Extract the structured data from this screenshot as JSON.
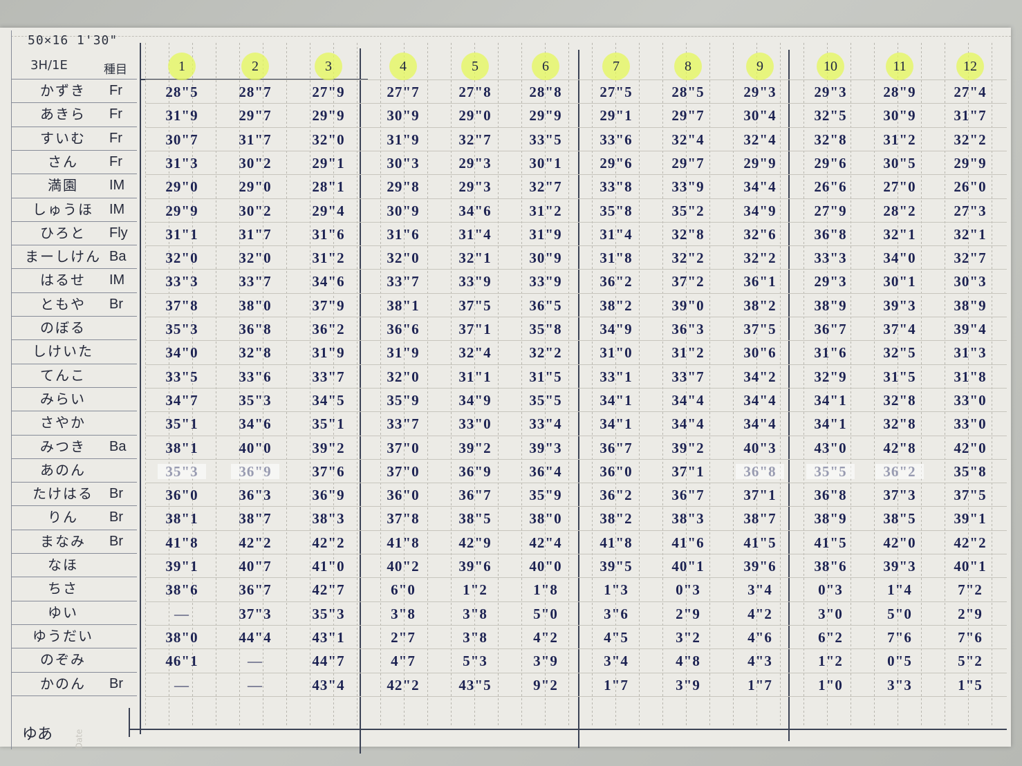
{
  "sheet": {
    "set_label": "50×16 1'30\"",
    "rule_label": "3H/1E",
    "kind_header": "種目",
    "last_name": "ゆあ",
    "date_label": "Date"
  },
  "columns": [
    "1",
    "2",
    "3",
    "4",
    "5",
    "6",
    "7",
    "8",
    "9",
    "10",
    "11",
    "12"
  ],
  "rows": [
    {
      "name": "かずき",
      "kind": "Fr",
      "times": [
        "28\"5",
        "28\"7",
        "27\"9",
        "27\"7",
        "27\"8",
        "28\"8",
        "27\"5",
        "28\"5",
        "29\"3",
        "29\"3",
        "28\"9",
        "27\"4"
      ]
    },
    {
      "name": "あきら",
      "kind": "Fr",
      "times": [
        "31\"9",
        "29\"7",
        "29\"9",
        "30\"9",
        "29\"0",
        "29\"9",
        "29\"1",
        "29\"7",
        "30\"4",
        "32\"5",
        "30\"9",
        "31\"7"
      ]
    },
    {
      "name": "すいむ",
      "kind": "Fr",
      "times": [
        "30\"7",
        "31\"7",
        "32\"0",
        "31\"9",
        "32\"7",
        "33\"5",
        "33\"6",
        "32\"4",
        "32\"4",
        "32\"8",
        "31\"2",
        "32\"2"
      ]
    },
    {
      "name": "さん",
      "kind": "Fr",
      "times": [
        "31\"3",
        "30\"2",
        "29\"1",
        "30\"3",
        "29\"3",
        "30\"1",
        "29\"6",
        "29\"7",
        "29\"9",
        "29\"6",
        "30\"5",
        "29\"9"
      ]
    },
    {
      "name": "満園",
      "kind": "IM",
      "times": [
        "29\"0",
        "29\"0",
        "28\"1",
        "29\"8",
        "29\"3",
        "32\"7",
        "33\"8",
        "33\"9",
        "34\"4",
        "26\"6",
        "27\"0",
        "26\"0"
      ]
    },
    {
      "name": "しゅうほ",
      "kind": "IM",
      "times": [
        "29\"9",
        "30\"2",
        "29\"4",
        "30\"9",
        "34\"6",
        "31\"2",
        "35\"8",
        "35\"2",
        "34\"9",
        "27\"9",
        "28\"2",
        "27\"3"
      ]
    },
    {
      "name": "ひろと",
      "kind": "Fly",
      "times": [
        "31\"1",
        "31\"7",
        "31\"6",
        "31\"6",
        "31\"4",
        "31\"9",
        "31\"4",
        "32\"8",
        "32\"6",
        "36\"8",
        "32\"1",
        "32\"1"
      ]
    },
    {
      "name": "まーしけん",
      "kind": "Ba",
      "times": [
        "32\"0",
        "32\"0",
        "31\"2",
        "32\"0",
        "32\"1",
        "30\"9",
        "31\"8",
        "32\"2",
        "32\"2",
        "33\"3",
        "34\"0",
        "32\"7"
      ]
    },
    {
      "name": "はるせ",
      "kind": "IM",
      "times": [
        "33\"3",
        "33\"7",
        "34\"6",
        "33\"7",
        "33\"9",
        "33\"9",
        "36\"2",
        "37\"2",
        "36\"1",
        "29\"3",
        "30\"1",
        "30\"3"
      ]
    },
    {
      "name": "ともや",
      "kind": "Br",
      "times": [
        "37\"8",
        "38\"0",
        "37\"9",
        "38\"1",
        "37\"5",
        "36\"5",
        "38\"2",
        "39\"0",
        "38\"2",
        "38\"9",
        "39\"3",
        "38\"9"
      ]
    },
    {
      "name": "のぼる",
      "kind": "",
      "times": [
        "35\"3",
        "36\"8",
        "36\"2",
        "36\"6",
        "37\"1",
        "35\"8",
        "34\"9",
        "36\"3",
        "37\"5",
        "36\"7",
        "37\"4",
        "39\"4"
      ]
    },
    {
      "name": "しけいた",
      "kind": "",
      "times": [
        "34\"0",
        "32\"8",
        "31\"9",
        "31\"9",
        "32\"4",
        "32\"2",
        "31\"0",
        "31\"2",
        "30\"6",
        "31\"6",
        "32\"5",
        "31\"3"
      ]
    },
    {
      "name": "てんこ",
      "kind": "",
      "times": [
        "33\"5",
        "33\"6",
        "33\"7",
        "32\"0",
        "31\"1",
        "31\"5",
        "33\"1",
        "33\"7",
        "34\"2",
        "32\"9",
        "31\"5",
        "31\"8"
      ]
    },
    {
      "name": "みらい",
      "kind": "",
      "times": [
        "34\"7",
        "35\"3",
        "34\"5",
        "35\"9",
        "34\"9",
        "35\"5",
        "34\"1",
        "34\"4",
        "34\"4",
        "34\"1",
        "32\"8",
        "33\"0"
      ]
    },
    {
      "name": "さやか",
      "kind": "",
      "times": [
        "35\"1",
        "34\"6",
        "35\"1",
        "33\"7",
        "33\"0",
        "33\"4",
        "34\"1",
        "34\"4",
        "34\"4",
        "34\"1",
        "32\"8",
        "33\"0"
      ]
    },
    {
      "name": "みつき",
      "kind": "Ba",
      "times": [
        "38\"1",
        "40\"0",
        "39\"2",
        "37\"0",
        "39\"2",
        "39\"3",
        "36\"7",
        "39\"2",
        "40\"3",
        "43\"0",
        "42\"8",
        "42\"0"
      ]
    },
    {
      "name": "あのん",
      "kind": "",
      "times": [
        "35\"3",
        "36\"9",
        "37\"6",
        "37\"0",
        "36\"9",
        "36\"4",
        "36\"0",
        "37\"1",
        "36\"8",
        "35\"5",
        "36\"2",
        "35\"8"
      ]
    },
    {
      "name": "たけはる",
      "kind": "Br",
      "times": [
        "36\"0",
        "36\"3",
        "36\"9",
        "36\"0",
        "36\"7",
        "35\"9",
        "36\"2",
        "36\"7",
        "37\"1",
        "36\"8",
        "37\"3",
        "37\"5"
      ]
    },
    {
      "name": "りん",
      "kind": "Br",
      "times": [
        "38\"1",
        "38\"7",
        "38\"3",
        "37\"8",
        "38\"5",
        "38\"0",
        "38\"2",
        "38\"3",
        "38\"7",
        "38\"9",
        "38\"5",
        "39\"1"
      ]
    },
    {
      "name": "まなみ",
      "kind": "Br",
      "times": [
        "41\"8",
        "42\"2",
        "42\"2",
        "41\"8",
        "42\"9",
        "42\"4",
        "41\"8",
        "41\"6",
        "41\"5",
        "41\"5",
        "42\"0",
        "42\"2"
      ]
    },
    {
      "name": "なほ",
      "kind": "",
      "times": [
        "39\"1",
        "40\"7",
        "41\"0",
        "40\"2",
        "39\"6",
        "40\"0",
        "39\"5",
        "40\"1",
        "39\"6",
        "38\"6",
        "39\"3",
        "40\"1"
      ]
    },
    {
      "name": "ちさ",
      "kind": "",
      "times": [
        "38\"6",
        "36\"7",
        "42\"7",
        "6\"0",
        "1\"2",
        "1\"8",
        "1\"3",
        "0\"3",
        "3\"4",
        "0\"3",
        "1\"4",
        "7\"2"
      ]
    },
    {
      "name": "ゆい",
      "kind": "",
      "times": [
        "—",
        "37\"3",
        "35\"3",
        "3\"8",
        "3\"8",
        "5\"0",
        "3\"6",
        "2\"9",
        "4\"2",
        "3\"0",
        "5\"0",
        "2\"9"
      ]
    },
    {
      "name": "ゆうだい",
      "kind": "",
      "times": [
        "38\"0",
        "44\"4",
        "43\"1",
        "2\"7",
        "3\"8",
        "4\"2",
        "4\"5",
        "3\"2",
        "4\"6",
        "6\"2",
        "7\"6",
        "7\"6"
      ]
    },
    {
      "name": "のぞみ",
      "kind": "",
      "times": [
        "46\"1",
        "—",
        "44\"7",
        "4\"7",
        "5\"3",
        "3\"9",
        "3\"4",
        "4\"8",
        "4\"3",
        "1\"2",
        "0\"5",
        "5\"2"
      ]
    },
    {
      "name": "かのん",
      "kind": "Br",
      "times": [
        "—",
        "—",
        "43\"4",
        "42\"2",
        "43\"5",
        "9\"2",
        "1\"7",
        "3\"9",
        "1\"7",
        "1\"0",
        "3\"3",
        "1\"5"
      ]
    }
  ]
}
